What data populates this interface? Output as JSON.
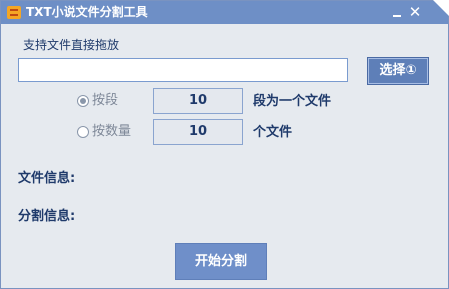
{
  "window": {
    "title": "TXT小说文件分割工具",
    "minimize_glyph": "–",
    "close_glyph": "✕",
    "title_color": "#6e8fc6"
  },
  "file_select": {
    "hint": "支持文件直接拖放",
    "path_value": "",
    "path_placeholder": "",
    "select_label": "选择①"
  },
  "options": {
    "by_paragraph": {
      "label": "按段",
      "checked": true,
      "value": "10",
      "suffix": "段为一个文件"
    },
    "by_count": {
      "label": "按数量",
      "checked": false,
      "value": "10",
      "suffix": "个文件"
    }
  },
  "info": {
    "file_info_label": "文件信息:",
    "split_info_label": "分割信息:"
  },
  "actions": {
    "start_label": "开始分割"
  },
  "icons": {
    "app": "txt-app-icon",
    "radio_checked": "radio-checked-icon",
    "radio_unchecked": "radio-unchecked-icon"
  }
}
